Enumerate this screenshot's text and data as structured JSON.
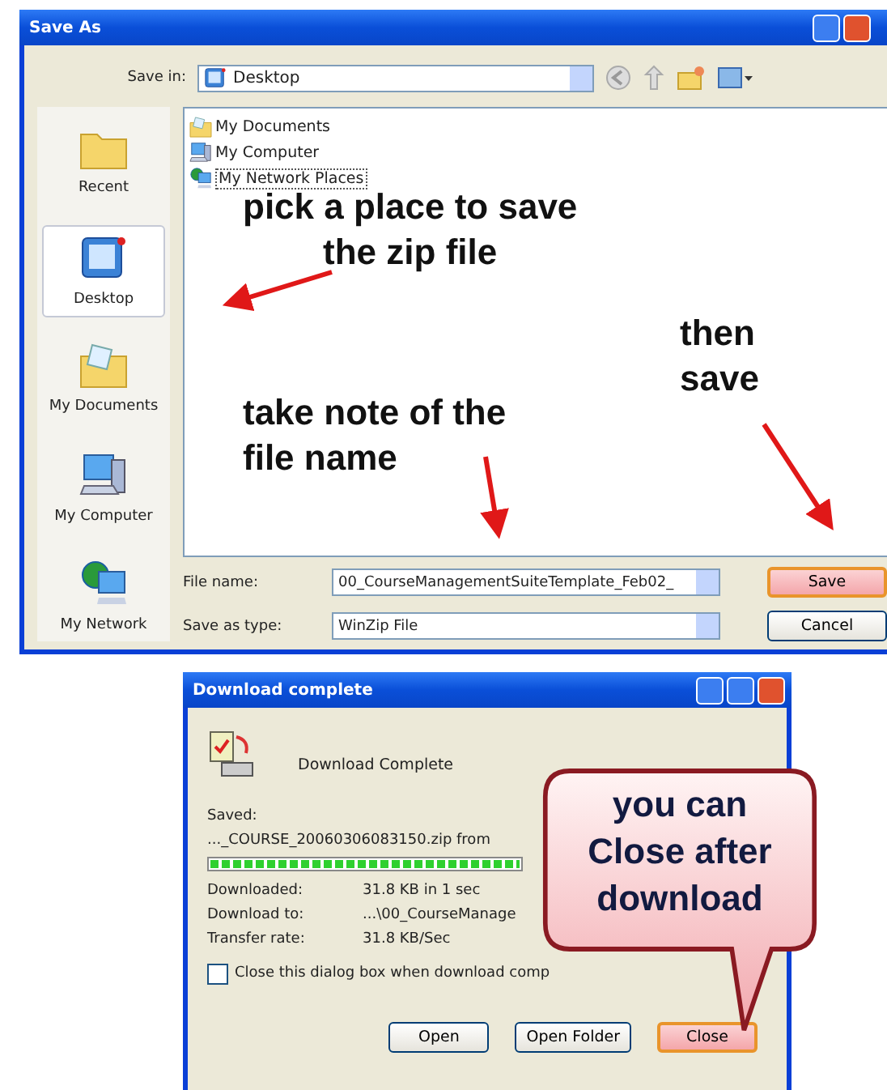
{
  "save_dialog": {
    "title": "Save As",
    "save_in_label": "Save in:",
    "save_in_value": "Desktop",
    "places": [
      {
        "label": "Recent",
        "kind": "recent",
        "selected": false
      },
      {
        "label": "Desktop",
        "kind": "desktop",
        "selected": true
      },
      {
        "label": "My Documents",
        "kind": "documents",
        "selected": false
      },
      {
        "label": "My Computer",
        "kind": "computer",
        "selected": false
      },
      {
        "label": "My Network",
        "kind": "network",
        "selected": false
      }
    ],
    "files": [
      {
        "name": "My Documents",
        "kind": "documents",
        "selected": false
      },
      {
        "name": "My Computer",
        "kind": "computer",
        "selected": false
      },
      {
        "name": "My Network Places",
        "kind": "network",
        "selected": true
      }
    ],
    "file_name_label": "File name:",
    "file_name_value": "00_CourseManagementSuiteTemplate_Feb02_",
    "save_type_label": "Save as type:",
    "save_type_value": "WinZip File",
    "buttons": [
      {
        "label": "Save",
        "highlighted": true
      },
      {
        "label": "Cancel",
        "highlighted": false
      }
    ]
  },
  "download_dialog": {
    "title": "Download complete",
    "heading": "Download Complete",
    "saved_label": "Saved:",
    "saved_file": "..._COURSE_20060306083150.zip from",
    "progress": {
      "level": 1
    },
    "details": [
      {
        "label": "Downloaded:",
        "value": "31.8 KB in 1 sec"
      },
      {
        "label": "Download to:",
        "value": "...\\00_CourseManage"
      },
      {
        "label": "Transfer rate:",
        "value": "31.8 KB/Sec"
      }
    ],
    "close_when_done": {
      "label": "Close this dialog box when download comp",
      "checked": false
    },
    "buttons": [
      {
        "label": "Open",
        "highlighted": false
      },
      {
        "label": "Open Folder",
        "highlighted": false
      },
      {
        "label": "Close",
        "highlighted": true
      }
    ]
  },
  "annotations": [
    {
      "kind": "note",
      "lines": [
        "pick a place to save",
        "the zip file"
      ]
    },
    {
      "kind": "note",
      "lines": [
        "then",
        "save"
      ]
    },
    {
      "kind": "note",
      "lines": [
        "take note of the",
        "file name"
      ]
    },
    {
      "kind": "callout",
      "lines": [
        "you can",
        "Close after",
        "download"
      ]
    }
  ]
}
